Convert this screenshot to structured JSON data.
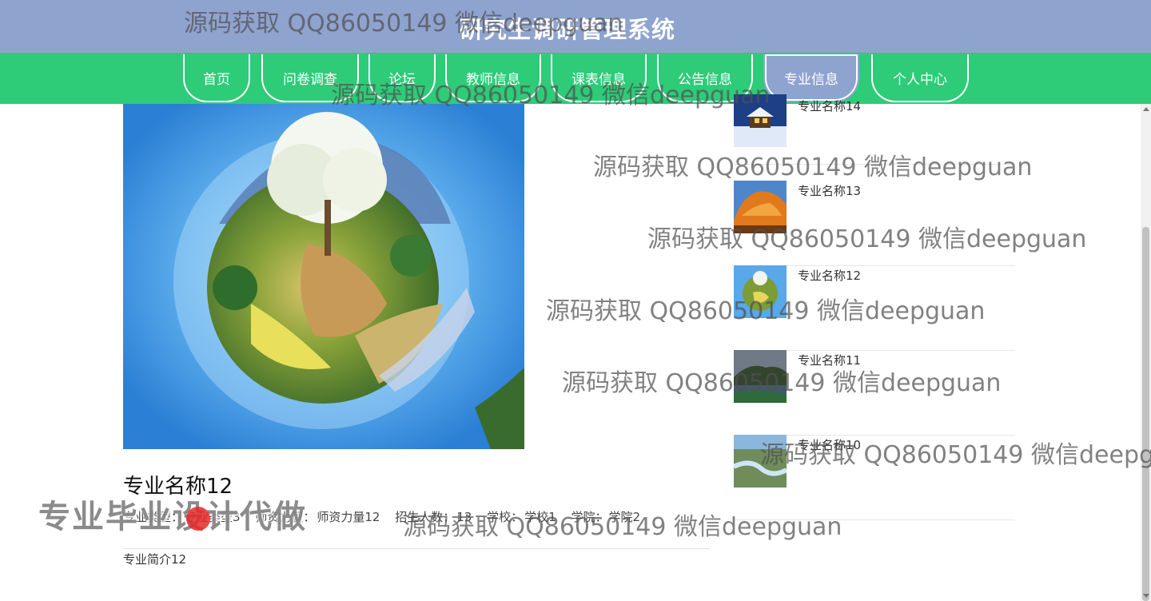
{
  "app": {
    "title": "研究生调研管理系统"
  },
  "nav": {
    "items": [
      {
        "label": "首页",
        "active": false
      },
      {
        "label": "问卷调查",
        "active": false
      },
      {
        "label": "论坛",
        "active": false
      },
      {
        "label": "教师信息",
        "active": false
      },
      {
        "label": "课表信息",
        "active": false
      },
      {
        "label": "公告信息",
        "active": false
      },
      {
        "label": "专业信息",
        "active": true
      },
      {
        "label": "个人中心",
        "active": false
      }
    ]
  },
  "detail": {
    "name": "专业名称12",
    "type_label": "专业类型：",
    "type_value": "专业类型3",
    "faculty_label": "师资力量：",
    "faculty_value": "师资力量12",
    "enroll_label": "招生人数：",
    "enroll_value": "13",
    "school_label": "学校：",
    "school_value": "学校1",
    "college_label": "学院：",
    "college_value": "学院2",
    "intro": "专业简介12"
  },
  "related": [
    {
      "name": "专业名称14",
      "thumb": "snow-cabin-image"
    },
    {
      "name": "专业名称13",
      "thumb": "orange-rock-image"
    },
    {
      "name": "专业名称12",
      "thumb": "tiny-planet-image"
    },
    {
      "name": "专业名称11",
      "thumb": "lake-hills-image"
    },
    {
      "name": "专业名称10",
      "thumb": "river-valley-image"
    }
  ],
  "watermarks": {
    "text": "源码获取 QQ86050149 微信deepguan",
    "badge": "专业毕业设计代做"
  },
  "colors": {
    "topbar": "#8fa3cf",
    "navbar": "#2ecb78",
    "nav_active": "#8fa3cf"
  }
}
